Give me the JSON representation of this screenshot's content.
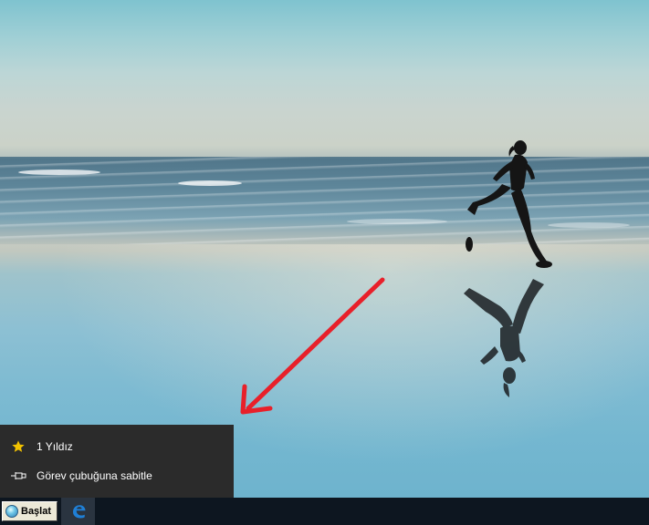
{
  "desktop": {
    "wallpaper": "beach-runner-wallpaper",
    "annotation": "red-arrow"
  },
  "jump_list": {
    "items": [
      {
        "label": "1 Yıldız",
        "icon": "star-icon",
        "icon_color": "#f2c200"
      },
      {
        "label": "Görev çubuğuna sabitle",
        "icon": "pin-icon",
        "icon_color": "#ffffff"
      }
    ]
  },
  "taskbar": {
    "start_label": "Başlat",
    "pinned": [
      {
        "app": "edge-icon",
        "color": "#1f7fd6"
      }
    ],
    "background": "#0d1620"
  },
  "colors": {
    "annotation_arrow": "#e8202a",
    "jumplist_bg": "#2b2b2b"
  }
}
